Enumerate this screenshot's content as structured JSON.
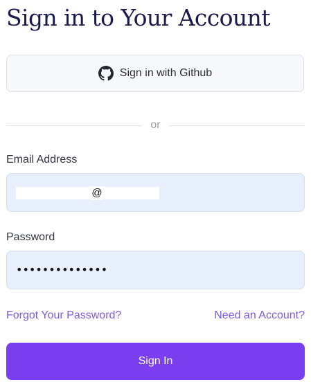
{
  "page": {
    "title": "Sign in to Your Account"
  },
  "github_button": {
    "icon": "github-icon",
    "label": "Sign in with Github"
  },
  "divider": {
    "text": "or"
  },
  "email": {
    "label": "Email Address",
    "value_visible": "@"
  },
  "password": {
    "label": "Password",
    "value": "••••••••••••••"
  },
  "links": {
    "forgot": "Forgot Your Password?",
    "register": "Need an Account?"
  },
  "submit": {
    "label": "Sign In"
  },
  "colors": {
    "title": "#1c1b4d",
    "accent": "#7a3ef0",
    "link": "#7c5ae0",
    "input_bg": "#e8effd"
  }
}
